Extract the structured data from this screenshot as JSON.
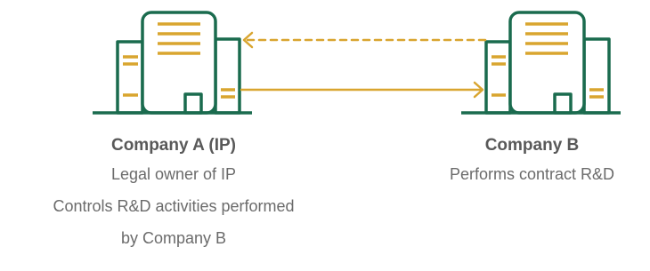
{
  "colors": {
    "building_outline": "#1a6b4e",
    "building_lines": "#d9a52f",
    "arrow": "#d9a52f",
    "title_text": "#595959",
    "desc_text": "#6b6b6b"
  },
  "icons": {
    "company_a": "office-building-icon",
    "company_b": "office-building-icon"
  },
  "company_a": {
    "title": "Company A (IP)",
    "lines": [
      "Legal owner of IP",
      "Controls R&D activities performed",
      "by Company B"
    ]
  },
  "company_b": {
    "title": "Company B",
    "lines": [
      "Performs contract R&D"
    ]
  },
  "arrows": {
    "a_to_b": "solid",
    "b_to_a": "dashed"
  }
}
